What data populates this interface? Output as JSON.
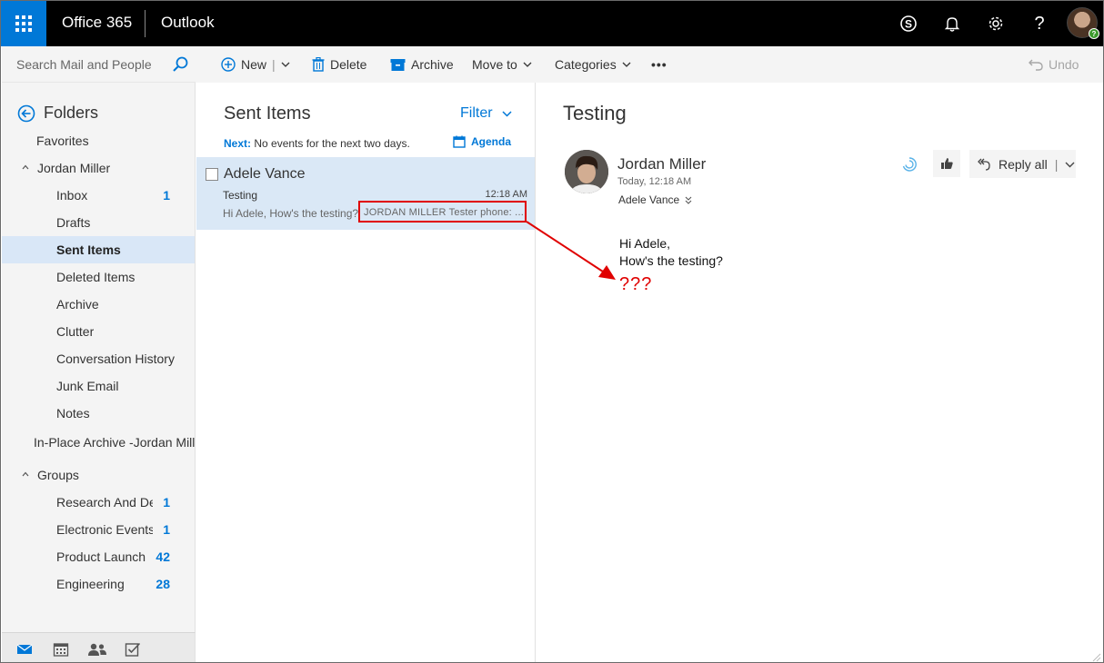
{
  "app": {
    "suite": "Office 365",
    "name": "Outlook"
  },
  "topbar": {
    "icons": [
      "skype-icon",
      "bell-icon",
      "gear-icon",
      "help-icon",
      "avatar"
    ],
    "help_glyph": "?"
  },
  "search": {
    "placeholder": "Search Mail and People"
  },
  "commands": {
    "new_label": "New",
    "delete_label": "Delete",
    "archive_label": "Archive",
    "moveto_label": "Move to",
    "categories_label": "Categories",
    "more_label": "•••",
    "undo_label": "Undo"
  },
  "nav": {
    "folders_label": "Folders",
    "favorites_label": "Favorites",
    "account_label": "Jordan Miller",
    "items": [
      {
        "label": "Inbox",
        "count": "1"
      },
      {
        "label": "Drafts",
        "count": ""
      },
      {
        "label": "Sent Items",
        "count": ""
      },
      {
        "label": "Deleted Items",
        "count": ""
      },
      {
        "label": "Archive",
        "count": ""
      },
      {
        "label": "Clutter",
        "count": ""
      },
      {
        "label": "Conversation History",
        "count": ""
      },
      {
        "label": "Junk Email",
        "count": ""
      },
      {
        "label": "Notes",
        "count": ""
      }
    ],
    "inplace_archive_label": "In-Place Archive -Jordan Mille",
    "groups_label": "Groups",
    "groups": [
      {
        "label": "Research And De",
        "count": "1"
      },
      {
        "label": "Electronic Events",
        "count": "1"
      },
      {
        "label": "Product Launch E",
        "count": "42"
      },
      {
        "label": "Engineering",
        "count": "28"
      }
    ]
  },
  "list": {
    "title": "Sent Items",
    "filter_label": "Filter",
    "next_label": "Next:",
    "next_text": "No events for the next two days.",
    "agenda_label": "Agenda",
    "message": {
      "from": "Adele Vance",
      "subject": "Testing",
      "time": "12:18 AM",
      "preview": "Hi Adele,  How's the testing?",
      "preview_tail": "JORDAN MILLER Tester phone: ..."
    }
  },
  "reading": {
    "subject": "Testing",
    "sender": "Jordan Miller",
    "sent_time": "Today, 12:18 AM",
    "to": "Adele Vance",
    "reply_all_label": "Reply all",
    "body_line1": "Hi Adele,",
    "body_line2": "How's the testing?"
  },
  "annotation": {
    "text": "???",
    "color": "#e00000"
  },
  "colors": {
    "accent": "#0078d7",
    "topbar": "#000000",
    "selected": "#dae8f6"
  }
}
